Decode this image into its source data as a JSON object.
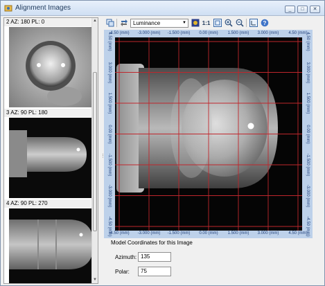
{
  "window": {
    "title": "Alignment Images",
    "min": "_",
    "max": "□",
    "close": "✕"
  },
  "thumbnails": [
    {
      "label": "2 AZ: 180  PL: 0"
    },
    {
      "label": "3 AZ: 90  PL: 180"
    },
    {
      "label": "4 AZ: 90  PL: 270"
    }
  ],
  "toolbar": {
    "mode_value": "Luminance",
    "one_to_one": "1:1",
    "icons": [
      "copy-image-icon",
      "flip-icon",
      "color-map-icon",
      "fit-to-window-icon",
      "zoom-in-icon",
      "zoom-out-icon",
      "coordinates-icon",
      "help-icon"
    ]
  },
  "axes": {
    "x_ticks": [
      "-4.50 (mm)",
      "-3.000 (mm)",
      "-1.500 (mm)",
      "0.00 (mm)",
      "1.500 (mm)",
      "3.000 (mm)",
      "4.50 (mm)"
    ],
    "y_ticks": [
      "4.50 (mm)",
      "3.000 (mm)",
      "1.500 (mm)",
      "0.00 (mm)",
      "-1.500 (mm)",
      "-3.000 (mm)",
      "-4.50 (mm)"
    ]
  },
  "model_coords": {
    "title": "Model Coordinates for this Image",
    "azimuth_label": "Azimuth:",
    "azimuth_value": "135",
    "polar_label": "Polar:",
    "polar_value": "75"
  },
  "colors": {
    "grid": "#c0262c",
    "accent": "#1f3f7a"
  }
}
